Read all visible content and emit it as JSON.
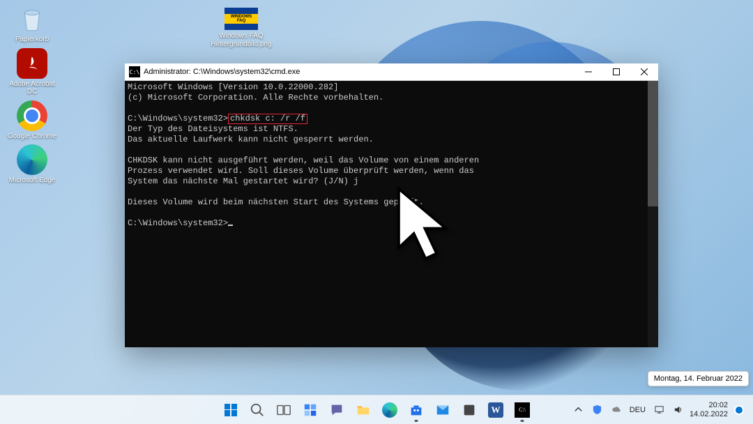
{
  "desktop": {
    "icons": [
      {
        "label": "Papierkorb"
      },
      {
        "label": "Adobe Acrobat DC"
      },
      {
        "label": "Google Chrome"
      },
      {
        "label": "Microsoft Edge"
      }
    ],
    "file": {
      "label": "Windows FAQ Hintergrundbild.png",
      "thumb_text": "WINDOWS FAQ"
    }
  },
  "cmd": {
    "icon_text": "C:\\",
    "title": "Administrator: C:\\Windows\\system32\\cmd.exe",
    "line1": "Microsoft Windows [Version 10.0.22000.282]",
    "line2": "(c) Microsoft Corporation. Alle Rechte vorbehalten.",
    "prompt1_pre": "C:\\Windows\\system32>",
    "prompt1_cmd": "chkdsk c: /r /f",
    "l3": "Der Typ des Dateisystems ist NTFS.",
    "l4": "Das aktuelle Laufwerk kann nicht gesperrt werden.",
    "l5": "CHKDSK kann nicht ausgeführt werden, weil das Volume von einem anderen",
    "l6": "Prozess verwendet wird. Soll dieses Volume überprüft werden, wenn das",
    "l7": "System das nächste Mal gestartet wird? (J/N) j",
    "l8": "Dieses Volume wird beim nächsten Start des Systems geprüft.",
    "prompt2": "C:\\Windows\\system32>"
  },
  "tooltip": "Montag, 14. Februar 2022",
  "systray": {
    "lang": "DEU",
    "time": "20:02",
    "date": "14.02.2022"
  }
}
